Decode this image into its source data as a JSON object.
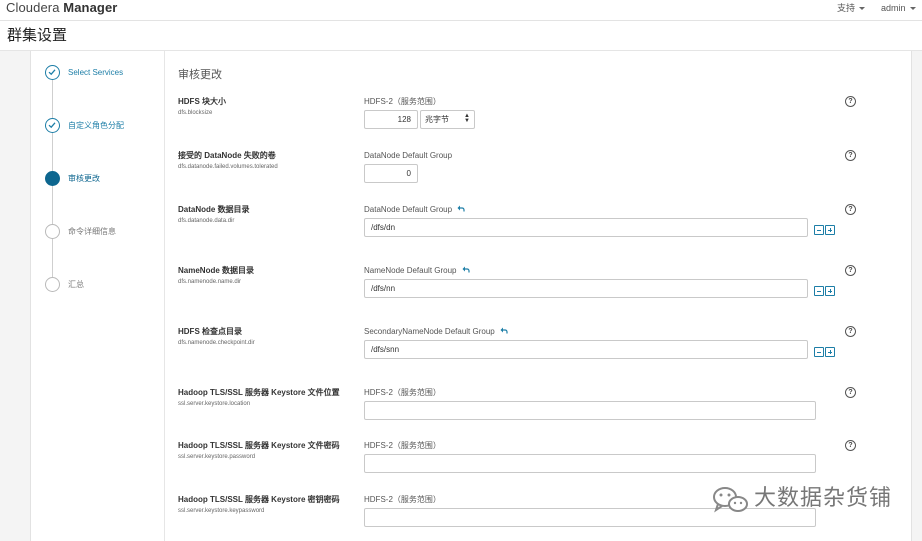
{
  "header": {
    "brand_light": "Cloudera",
    "brand_bold": "Manager",
    "support_label": "支持",
    "user_label": "admin"
  },
  "page": {
    "title": "群集设置"
  },
  "steps": [
    {
      "label": "Select Services",
      "state": "done"
    },
    {
      "label": "自定义角色分配",
      "state": "done"
    },
    {
      "label": "审核更改",
      "state": "active"
    },
    {
      "label": "命令详细信息",
      "state": "todo"
    },
    {
      "label": "汇总",
      "state": "todo"
    }
  ],
  "section_title": "审核更改",
  "props": [
    {
      "name": "HDFS 块大小",
      "key": "dfs.blocksize",
      "scope": "HDFS-2（服务范围）",
      "value": "128",
      "unit": "兆字节"
    },
    {
      "name": "接受的 DataNode 失败的卷",
      "key": "dfs.datanode.failed.volumes.tolerated",
      "scope": "DataNode Default Group",
      "value": "0"
    },
    {
      "name": "DataNode 数据目录",
      "key": "dfs.datanode.data.dir",
      "scope": "DataNode Default Group",
      "value": "/dfs/dn"
    },
    {
      "name": "NameNode 数据目录",
      "key": "dfs.namenode.name.dir",
      "scope": "NameNode Default Group",
      "value": "/dfs/nn"
    },
    {
      "name": "HDFS 检查点目录",
      "key": "dfs.namenode.checkpoint.dir",
      "scope": "SecondaryNameNode Default Group",
      "value": "/dfs/snn"
    },
    {
      "name": "Hadoop TLS/SSL 服务器 Keystore 文件位置",
      "key": "ssl.server.keystore.location",
      "scope": "HDFS-2（服务范围）",
      "value": ""
    },
    {
      "name": "Hadoop TLS/SSL 服务器 Keystore 文件密码",
      "key": "ssl.server.keystore.password",
      "scope": "HDFS-2（服务范围）",
      "value": ""
    },
    {
      "name": "Hadoop TLS/SSL 服务器 Keystore 密钥密码",
      "key": "ssl.server.keystore.keypassword",
      "scope": "HDFS-2（服务范围）",
      "value": ""
    }
  ],
  "help_glyph": "?",
  "watermark": {
    "text": "大数据杂货铺"
  },
  "colors": {
    "accent": "#1d7ea7",
    "active": "#0d668f",
    "border": "#c9c9c9"
  }
}
